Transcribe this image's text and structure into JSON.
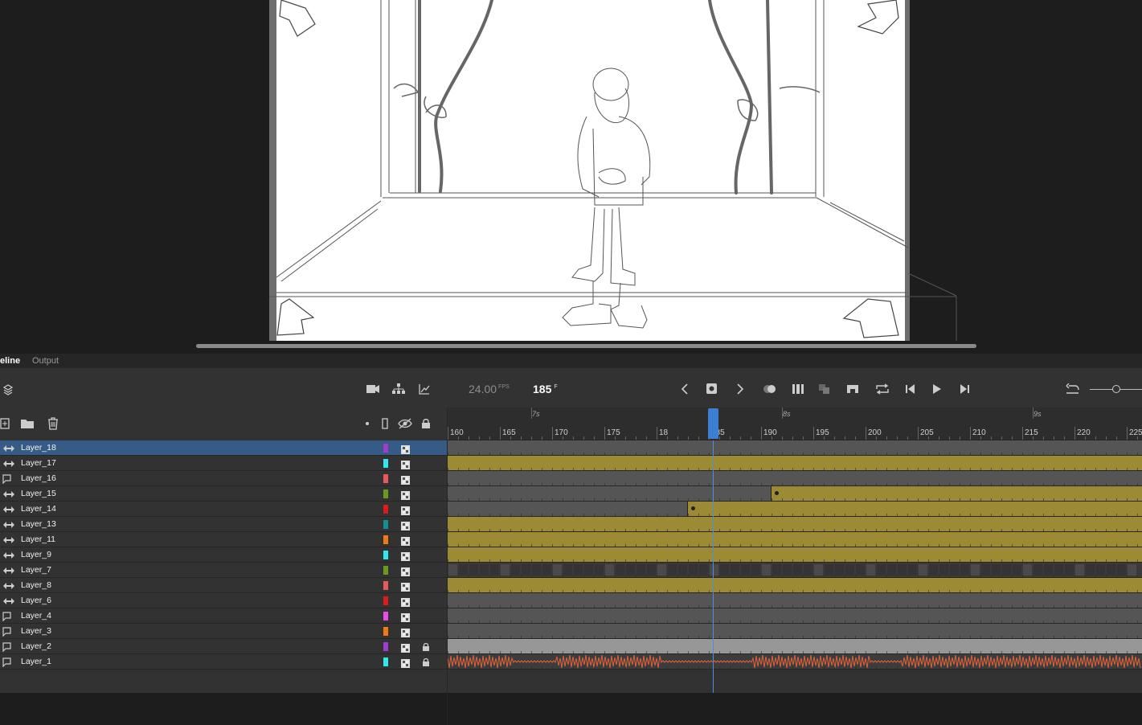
{
  "tabs": [
    {
      "label": "eline",
      "active": true
    },
    {
      "label": "Output",
      "active": false
    }
  ],
  "toolbar": {
    "fps_value": "24.00",
    "fps_unit": "FPS",
    "frame_value": "185",
    "frame_unit": "F",
    "left_icons": [
      "layers-icon"
    ],
    "right_icons": [
      "camera-icon",
      "hierarchy-icon",
      "graph-icon"
    ],
    "playback_icons": [
      "prev-keyframe-icon",
      "insert-keyframe-icon",
      "next-keyframe-icon",
      "onion-skin-icon",
      "edit-multiple-frames-icon",
      "onion-outline-icon",
      "center-frame-icon",
      "loop-icon",
      "step-back-icon",
      "play-icon",
      "step-forward-icon"
    ],
    "zoom_icons": [
      "undo-icon",
      "zoom-slider"
    ]
  },
  "layer_tools": {
    "icons": [
      "new-layer-icon",
      "new-folder-icon",
      "delete-icon"
    ],
    "column_icons": [
      "dot-icon",
      "outline-icon",
      "visibility-icon",
      "lock-icon"
    ]
  },
  "ruler": {
    "frames": [
      "160",
      "165",
      "170",
      "175",
      "18",
      "185",
      "190",
      "195",
      "200",
      "205",
      "210",
      "215",
      "220",
      "225"
    ],
    "seconds": [
      "7s",
      "8s",
      "9s"
    ]
  },
  "layers": [
    {
      "name": "Layer_18",
      "color": "#a23ccf",
      "selected": true,
      "type": "tween",
      "locked": false
    },
    {
      "name": "Layer_17",
      "color": "#2de8f0",
      "selected": false,
      "type": "tween",
      "locked": false
    },
    {
      "name": "Layer_16",
      "color": "#e85a5a",
      "selected": false,
      "type": "normal",
      "locked": false
    },
    {
      "name": "Layer_15",
      "color": "#6a9a1a",
      "selected": false,
      "type": "tween",
      "locked": false
    },
    {
      "name": "Layer_14",
      "color": "#e01a1a",
      "selected": false,
      "type": "tween",
      "locked": false
    },
    {
      "name": "Layer_13",
      "color": "#138f8f",
      "selected": false,
      "type": "tween",
      "locked": false
    },
    {
      "name": "Layer_11",
      "color": "#f07b10",
      "selected": false,
      "type": "tween",
      "locked": false
    },
    {
      "name": "Layer_9",
      "color": "#2de8f0",
      "selected": false,
      "type": "tween",
      "locked": false
    },
    {
      "name": "Layer_7",
      "color": "#6a9a1a",
      "selected": false,
      "type": "tween",
      "locked": false
    },
    {
      "name": "Layer_8",
      "color": "#e85a5a",
      "selected": false,
      "type": "tween",
      "locked": false
    },
    {
      "name": "Layer_6",
      "color": "#e01a1a",
      "selected": false,
      "type": "tween",
      "locked": false
    },
    {
      "name": "Layer_4",
      "color": "#e84be8",
      "selected": false,
      "type": "normal",
      "locked": false
    },
    {
      "name": "Layer_3",
      "color": "#f07b10",
      "selected": false,
      "type": "normal",
      "locked": false
    },
    {
      "name": "Layer_2",
      "color": "#a23ccf",
      "selected": false,
      "type": "normal",
      "locked": true
    },
    {
      "name": "Layer_1",
      "color": "#2de8f0",
      "selected": false,
      "type": "normal",
      "locked": true
    }
  ],
  "colors": {
    "gold_track": "#9d8a34",
    "gray_track": "#555555",
    "selection": "#365b86",
    "playhead": "#3c7fd2",
    "audio_wave": "#e0623a"
  }
}
